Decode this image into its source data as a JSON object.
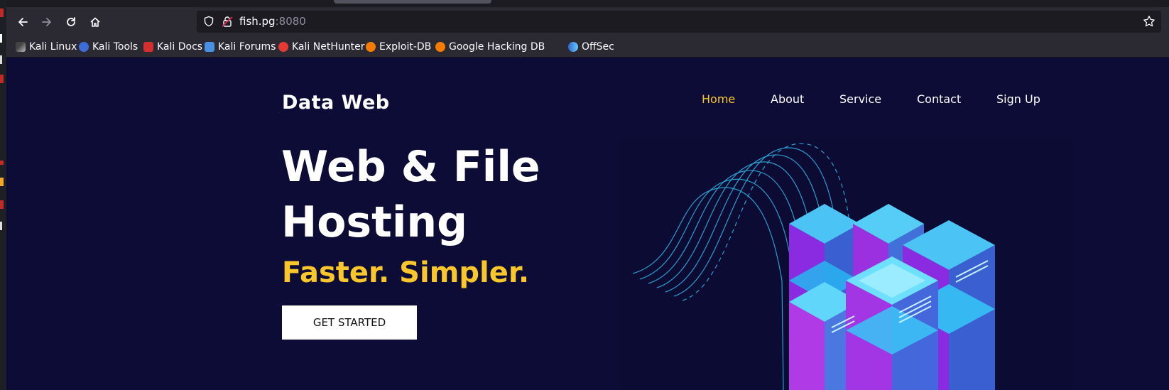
{
  "browser": {
    "url_host": "fish.pg",
    "url_port": ":8080",
    "bookmarks": [
      {
        "label": "Kali Linux",
        "icon": "kali-dragon-icon"
      },
      {
        "label": "Kali Tools",
        "icon": "kali-tools-icon"
      },
      {
        "label": "Kali Docs",
        "icon": "kali-docs-icon"
      },
      {
        "label": "Kali Forums",
        "icon": "kali-forums-icon"
      },
      {
        "label": "Kali NetHunter",
        "icon": "nethunter-icon"
      },
      {
        "label": "Exploit-DB",
        "icon": "exploit-db-icon"
      },
      {
        "label": "Google Hacking DB",
        "icon": "ghdb-icon"
      },
      {
        "label": "OffSec",
        "icon": "offsec-icon"
      }
    ]
  },
  "site": {
    "logo": "Data Web",
    "nav": [
      {
        "label": "Home",
        "active": true
      },
      {
        "label": "About",
        "active": false
      },
      {
        "label": "Service",
        "active": false
      },
      {
        "label": "Contact",
        "active": false
      },
      {
        "label": "Sign Up",
        "active": false
      }
    ],
    "hero": {
      "title_line1": "Web & File",
      "title_line2": "Hosting",
      "tagline": "Faster. Simpler.",
      "cta": "GET STARTED"
    }
  },
  "colors": {
    "page_bg": "#0d0c36",
    "accent": "#f9c62b",
    "chrome_bg": "#2b2a33"
  }
}
